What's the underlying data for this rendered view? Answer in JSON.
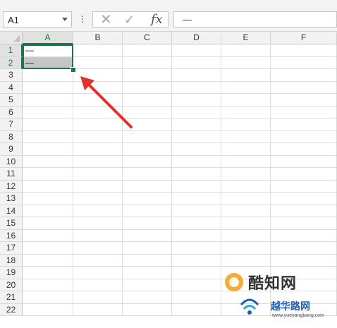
{
  "formula_bar": {
    "name_box": "A1",
    "cancel_icon": "✕",
    "enter_icon": "✓",
    "fx_label": "fx",
    "content": "—"
  },
  "columns": [
    "A",
    "B",
    "C",
    "D",
    "E",
    "F"
  ],
  "rows": [
    "1",
    "2",
    "3",
    "4",
    "5",
    "6",
    "7",
    "8",
    "9",
    "10",
    "11",
    "12",
    "13",
    "14",
    "15",
    "16",
    "17",
    "18",
    "19",
    "20",
    "21",
    "22"
  ],
  "cells": {
    "A1": "—",
    "A2": "—"
  },
  "watermark": {
    "line1": "酷知网",
    "line2": "越华路网",
    "line3": "www.yueyangbang.com"
  },
  "colors": {
    "accent": "#217346",
    "arrow": "#e0322c",
    "selection_fill": "#c6c6c6"
  }
}
